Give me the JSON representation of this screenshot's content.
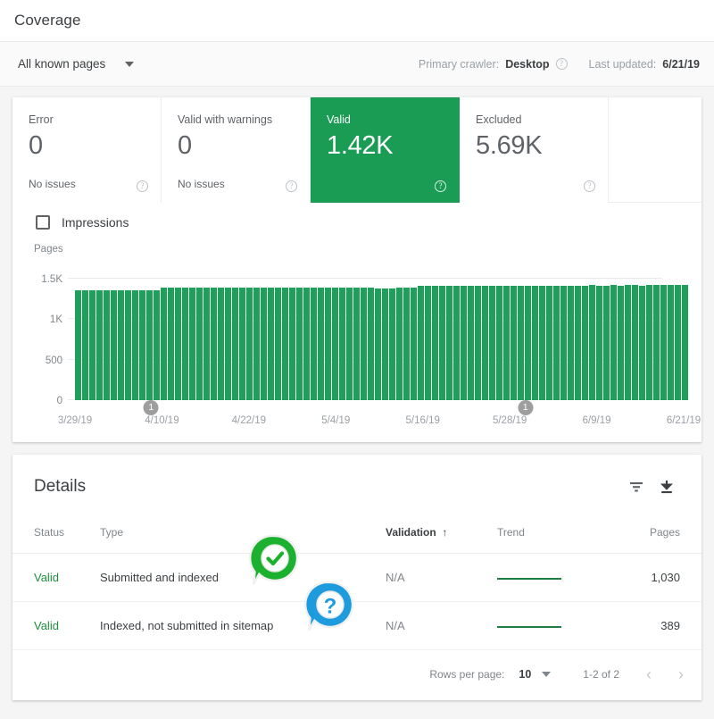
{
  "header": {
    "title": "Coverage"
  },
  "subheader": {
    "filter_label": "All known pages",
    "crawler_label": "Primary crawler:",
    "crawler_value": "Desktop",
    "updated_label": "Last updated:",
    "updated_value": "6/21/19",
    "help_icon": "help-icon"
  },
  "cards": [
    {
      "label": "Error",
      "value": "0",
      "sub": "No issues",
      "selected": false
    },
    {
      "label": "Valid with warnings",
      "value": "0",
      "sub": "No issues",
      "selected": false
    },
    {
      "label": "Valid",
      "value": "1.42K",
      "sub": "",
      "selected": true
    },
    {
      "label": "Excluded",
      "value": "5.69K",
      "sub": "",
      "selected": false
    }
  ],
  "chart_controls": {
    "impressions_label": "Impressions",
    "impressions_checked": false
  },
  "details": {
    "title": "Details",
    "filter_icon": "filter-icon",
    "download_icon": "download-icon",
    "columns": [
      "Status",
      "Type",
      "Validation",
      "Trend",
      "Pages"
    ],
    "sorted_column": "Validation",
    "sort_direction": "ascending",
    "rows": [
      {
        "status": "Valid",
        "type": "Submitted and indexed",
        "validation": "N/A",
        "trend": "flat",
        "pages": "1,030"
      },
      {
        "status": "Valid",
        "type": "Indexed, not submitted in sitemap",
        "validation": "N/A",
        "trend": "flat",
        "pages": "389"
      }
    ],
    "pager": {
      "rows_per_page_label": "Rows per page:",
      "rows_per_page_value": "10",
      "range": "1-2 of 2",
      "prev_icon": "chevron-left-icon",
      "next_icon": "chevron-right-icon"
    }
  },
  "overlays": [
    {
      "name": "green-check-badge",
      "glyph": "check",
      "color": "#1bb12e"
    },
    {
      "name": "blue-question-badge",
      "glyph": "question",
      "color": "#1d9bdd"
    }
  ],
  "colors": {
    "valid_green": "#1a9c54",
    "bar_green": "#1ea05a",
    "status_green": "#1e8e3e",
    "text": "#3c4043",
    "muted": "#80868b"
  },
  "chart_data": {
    "type": "bar",
    "title": "",
    "xlabel": "",
    "ylabel": "Pages",
    "ylim": [
      0,
      1500
    ],
    "yticks": [
      "0",
      "500",
      "1K",
      "1.5K"
    ],
    "ytick_values": [
      0,
      500,
      1000,
      1500
    ],
    "grid": true,
    "legend": "none",
    "categories": [
      "3/29/19",
      "4/10/19",
      "4/22/19",
      "5/4/19",
      "5/16/19",
      "5/28/19",
      "6/9/19",
      "6/21/19"
    ],
    "series": [
      {
        "name": "Valid pages",
        "color": "#1ea05a",
        "values": [
          1352,
          1360,
          1358,
          1356,
          1359,
          1357,
          1360,
          1355,
          1358,
          1356,
          1360,
          1357,
          1392,
          1394,
          1390,
          1393,
          1391,
          1395,
          1392,
          1390,
          1394,
          1391,
          1393,
          1390,
          1392,
          1394,
          1391,
          1393,
          1390,
          1392,
          1394,
          1391,
          1390,
          1393,
          1391,
          1392,
          1394,
          1391,
          1393,
          1390,
          1392,
          1391,
          1379,
          1381,
          1383,
          1386,
          1390,
          1393,
          1410,
          1412,
          1409,
          1411,
          1413,
          1410,
          1412,
          1409,
          1411,
          1413,
          1410,
          1412,
          1414,
          1411,
          1413,
          1415,
          1412,
          1414,
          1416,
          1413,
          1415,
          1417,
          1414,
          1416,
          1418,
          1415,
          1417,
          1419,
          1416,
          1418,
          1420,
          1417,
          1419,
          1421,
          1418,
          1420,
          1422,
          1419
        ]
      }
    ],
    "annotations": [
      {
        "label": "1",
        "x_position": 0.125
      },
      {
        "label": "1",
        "x_position": 0.74
      }
    ],
    "sparklines": [
      {
        "row": "Submitted and indexed",
        "trend": "flat",
        "value": 1030
      },
      {
        "row": "Indexed, not submitted in sitemap",
        "trend": "flat",
        "value": 389
      }
    ]
  }
}
